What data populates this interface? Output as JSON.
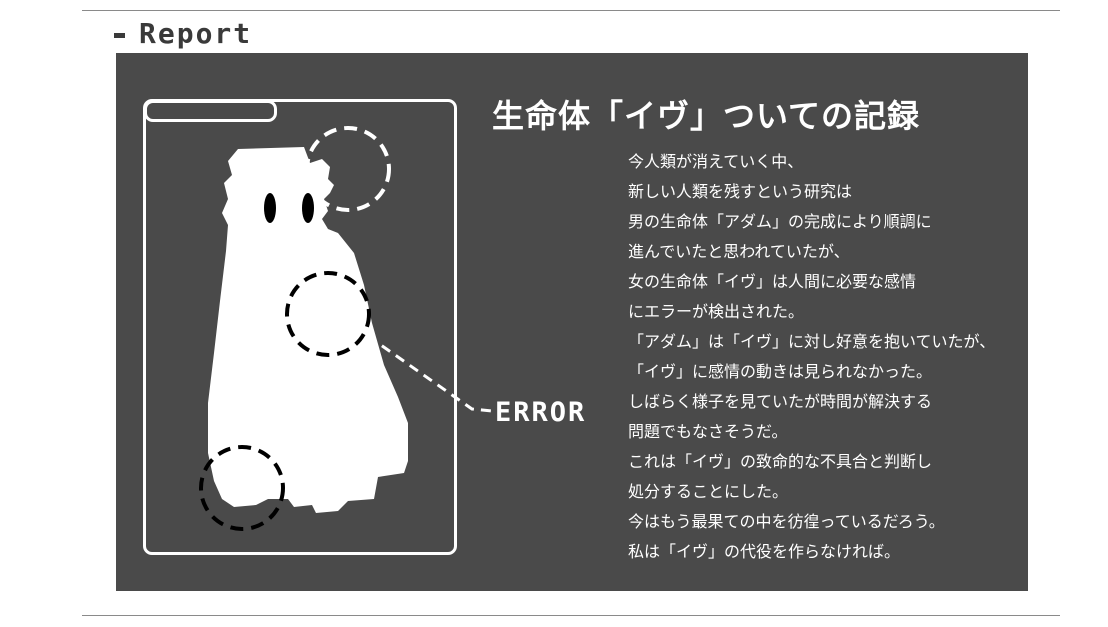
{
  "header": {
    "title": "Report"
  },
  "report": {
    "title": "生命体「イヴ」ついての記録",
    "error_label": "ERROR",
    "lines": [
      "今人類が消えていく中、",
      "新しい人類を残すという研究は",
      "男の生命体「アダム」の完成により順調に",
      "進んでいたと思われていたが、",
      "女の生命体「イヴ」は人間に必要な感情",
      "にエラーが検出された。",
      "「アダム」は「イヴ」に対し好意を抱いていたが、",
      "「イヴ」に感情の動きは見られなかった。",
      "しばらく様子を見ていたが時間が解決する",
      "問題でもなさそうだ。",
      "これは「イヴ」の致命的な不具合と判断し",
      "処分することにした。",
      "今はもう最果ての中を彷徨っているだろう。",
      "私は「イヴ」の代役を作らなければ。"
    ]
  },
  "colors": {
    "panel": "#4a4a4a",
    "ink": "#ffffff",
    "header": "#3a3a3a"
  }
}
